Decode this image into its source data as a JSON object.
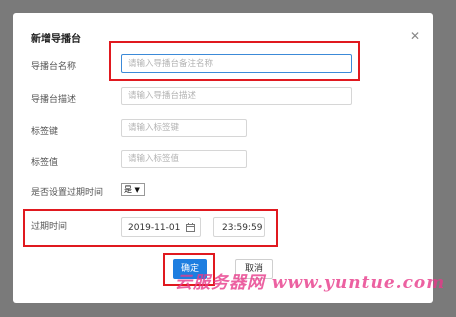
{
  "dialog": {
    "title": "新增导播台",
    "close_icon": "close-icon"
  },
  "fields": {
    "name": {
      "label": "导播台名称",
      "placeholder": "请输入导播台备注名称",
      "value": ""
    },
    "description": {
      "label": "导播台描述",
      "placeholder": "请输入导播台描述",
      "value": ""
    },
    "tag_key": {
      "label": "标签键",
      "placeholder": "请输入标签键",
      "value": ""
    },
    "tag_value": {
      "label": "标签值",
      "placeholder": "请输入标签值",
      "value": ""
    },
    "set_expiry": {
      "label": "是否设置过期时间",
      "selected": "是",
      "caret": "▼"
    },
    "expiry": {
      "label": "过期时间",
      "date": "2019-11-01",
      "time": "23:59:59",
      "date_icon": "calendar-icon"
    }
  },
  "buttons": {
    "confirm": "确定",
    "cancel": "取消"
  },
  "watermark": "云服务器网 www.yuntue.com",
  "colors": {
    "overlay": "#7a7a7a",
    "primary": "#1e7ee0",
    "annotation_red": "#e0191f",
    "watermark": "#e73989"
  }
}
